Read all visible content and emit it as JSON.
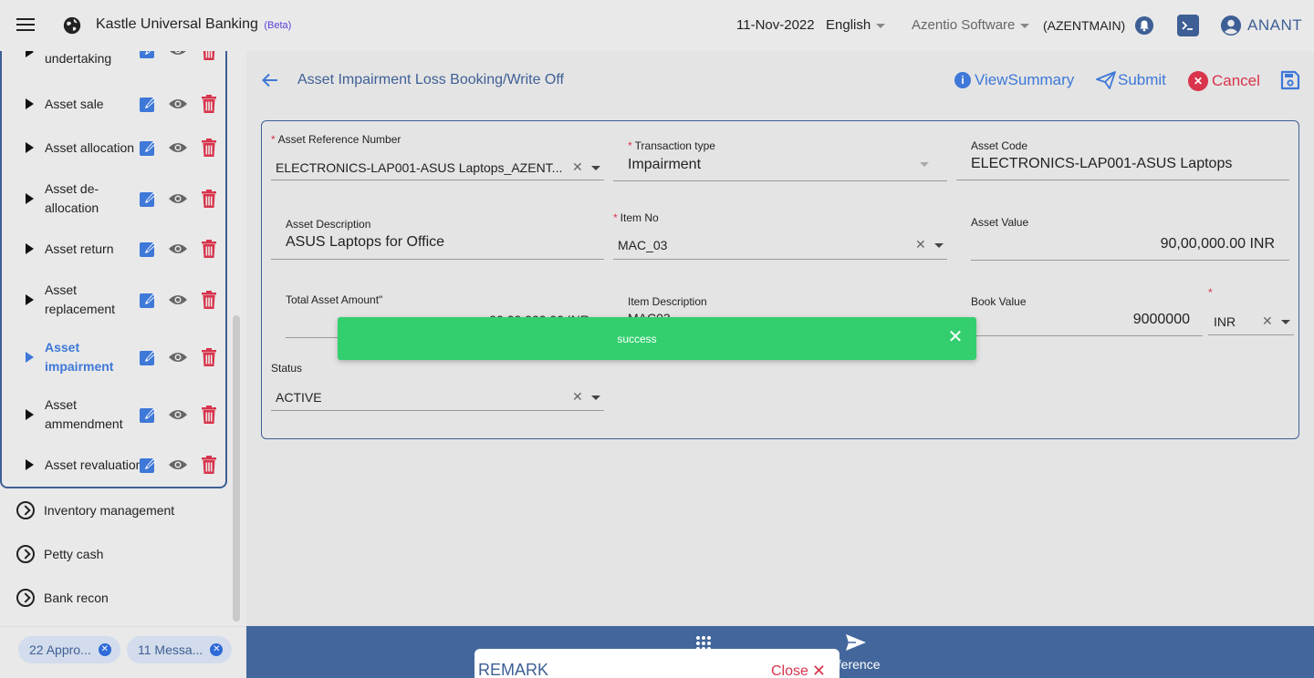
{
  "header": {
    "app_title": "Kastle Universal Banking",
    "beta": "(Beta)",
    "date": "11-Nov-2022",
    "language": "English",
    "company": "Azentio Software",
    "branch": "(AZENTMAIN)",
    "user": "ANANT"
  },
  "sidebar": {
    "sub_items": [
      {
        "label": "undertaking"
      },
      {
        "label": "Asset sale"
      },
      {
        "label": "Asset allocation"
      },
      {
        "label": "Asset de-allocation"
      },
      {
        "label": "Asset return"
      },
      {
        "label": "Asset replacement"
      },
      {
        "label": "Asset impairment"
      },
      {
        "label": "Asset ammendment"
      },
      {
        "label": "Asset revaluation"
      }
    ],
    "main_items": [
      {
        "label": "Inventory management"
      },
      {
        "label": "Petty cash"
      },
      {
        "label": "Bank recon"
      }
    ],
    "chips": [
      {
        "label": "22 Appro..."
      },
      {
        "label": "11 Messa..."
      }
    ]
  },
  "page": {
    "title": "Asset Impairment Loss Booking/Write Off",
    "actions": {
      "view_summary": "ViewSummary",
      "submit": "Submit",
      "cancel": "Cancel"
    }
  },
  "form": {
    "asset_ref": {
      "label": "Asset Reference Number",
      "value": "ELECTRONICS-LAP001-ASUS Laptops_AZENT..."
    },
    "transaction_type": {
      "label": "Transaction type",
      "value": "Impairment"
    },
    "asset_code": {
      "label": "Asset Code",
      "value": "ELECTRONICS-LAP001-ASUS Laptops"
    },
    "asset_description": {
      "label": "Asset Description",
      "value": "ASUS Laptops for Office"
    },
    "item_no": {
      "label": "Item No",
      "value": "MAC_03"
    },
    "asset_value": {
      "label": "Asset Value",
      "value": "90,00,000.00 INR"
    },
    "total_asset_amount": {
      "label": "Total Asset Amount\"",
      "value": "90,00,000.00 INR"
    },
    "item_description": {
      "label": "Item Description",
      "value": "MAC03"
    },
    "book_value": {
      "label": "Book Value",
      "value": "9000000"
    },
    "currency": {
      "value": "INR"
    },
    "status": {
      "label": "Status",
      "value": "ACTIVE"
    }
  },
  "toast": {
    "message": "success"
  },
  "bottom": {
    "reference_label": "eference",
    "remark_title": "REMARK",
    "remark_close": "Close"
  }
}
